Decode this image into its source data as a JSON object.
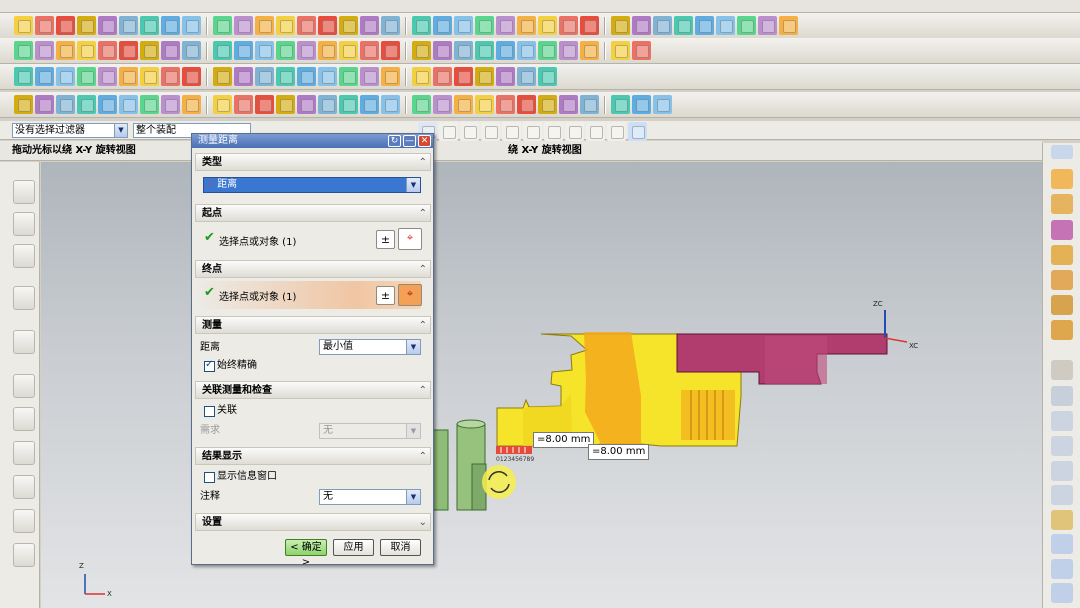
{
  "toolbar_rows": [
    {
      "icons": [
        "sketch-icon",
        "line-icon",
        "arc-icon",
        "cylinder-icon",
        "cube-icon",
        "sphere-icon",
        "cone-icon",
        "torus-icon",
        "extrude-icon",
        "revolve-icon",
        "sweep-icon",
        "blend-icon",
        "chamfer-icon",
        "hole-icon",
        "boss-icon",
        "pocket-icon",
        "pad-icon",
        "slot-icon",
        "groove-icon",
        "rib-icon",
        "shell-icon",
        "draft-icon",
        "offset-icon",
        "thicken-icon",
        "trim-icon",
        "split-icon",
        "unite-icon",
        "subtract-icon",
        "intersect-icon",
        "pattern-icon",
        "mirror-icon",
        "move-icon",
        "curve-icon",
        "spline-icon",
        "point-icon",
        "plane-icon"
      ]
    },
    {
      "icons": [
        "component-icon",
        "assembly-icon",
        "mate-icon",
        "constraint-icon",
        "explode-icon",
        "sequence-icon",
        "clearance-icon",
        "wave-icon",
        "reference-icon",
        "link-icon",
        "measure-icon",
        "calculator-icon",
        "grid-icon",
        "table-icon",
        "view-icon",
        "layer-icon",
        "angle-icon",
        "clock-icon",
        "hourglass-icon",
        "arrow-icon",
        "sheet-icon",
        "mold-icon",
        "insert-icon",
        "slide-icon",
        "lifter-icon",
        "ejector-icon",
        "cooling-icon",
        "runner-icon",
        "gate-icon"
      ]
    },
    {
      "icons": [
        "body-icon",
        "face-icon",
        "edge-icon",
        "vertex-icon",
        "grid-icon",
        "pattern-icon",
        "line-icon",
        "circle-icon",
        "lines-icon",
        "dim-icon",
        "table-icon",
        "angle-icon",
        "symbol-icon",
        "delete-icon",
        "move-icon",
        "copy-icon",
        "paste-icon",
        "rotate-icon",
        "scale-icon",
        "align-icon",
        "distribute-icon",
        "snap-icon",
        "refresh-icon",
        "cursor-icon",
        "select-icon"
      ]
    },
    {
      "icons": [
        "shade-icon",
        "wire-icon",
        "hidden-icon",
        "box-icon",
        "line-icon",
        "solid-icon",
        "face-icon",
        "dark-icon",
        "pin-icon",
        "surface-icon",
        "fill-icon",
        "plate-icon",
        "point-icon",
        "red-icon",
        "magenta-icon",
        "yellow-icon",
        "orange-icon",
        "red-diamond-icon",
        "bolt-icon",
        "screw-icon",
        "sphere-icon",
        "ring-icon",
        "ring2-icon",
        "ring3-icon",
        "ring4-icon",
        "nut-icon",
        "pin2-icon",
        "table-icon",
        "pin3-icon",
        "pin4-icon"
      ]
    }
  ],
  "filter_bar": {
    "selection_filter": "没有选择过滤器",
    "assembly_scope": "整个装配"
  },
  "cue_line": {
    "left": "拖动光标以绕 X-Y 旋转视图",
    "center": "绕 X-Y 旋转视图"
  },
  "dialog": {
    "title": "测量距离",
    "type_section": "类型",
    "type_value": "距离",
    "start_section": "起点",
    "start_select": "选择点或对象 (1)",
    "end_section": "终点",
    "end_select": "选择点或对象 (1)",
    "measure_section": "测量",
    "distance_label": "距离",
    "distance_value": "最小值",
    "always_accurate": "始终精确",
    "assoc_section": "关联测量和检查",
    "assoc_label": "关联",
    "requirement_label": "需求",
    "requirement_value": "无",
    "result_section": "结果显示",
    "show_info_window": "显示信息窗口",
    "annotation_label": "注释",
    "annotation_value": "无",
    "settings_section": "设置",
    "ok": "< 确定 >",
    "apply": "应用",
    "cancel": "取消"
  },
  "viewport": {
    "dim_label_1": "=8.00 mm",
    "dim_label_2": "=8.00 mm",
    "ruler_label": "0123456789",
    "axis_zc": "ZC",
    "axis_xc": "XC",
    "triad_z": "Z",
    "triad_x": "X"
  },
  "colors": {
    "part_yellow": "#f5e42a",
    "part_magenta": "#b03d6e",
    "part_orange": "#f2a91c",
    "green_pins": "#8fbc76",
    "dialog_highlight": "#f0c6a4"
  }
}
